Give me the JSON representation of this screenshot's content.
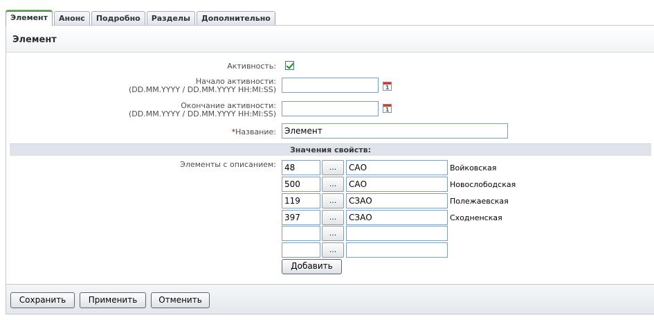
{
  "tabs": [
    {
      "label": "Элемент",
      "active": true
    },
    {
      "label": "Анонс"
    },
    {
      "label": "Подробно"
    },
    {
      "label": "Разделы"
    },
    {
      "label": "Дополнительно"
    }
  ],
  "panel": {
    "title": "Элемент"
  },
  "form": {
    "active_label": "Активность:",
    "active_checked": true,
    "start_label": "Начало активности:",
    "start_format": "(DD.MM.YYYY / DD.MM.YYYY HH:MI:SS)",
    "start_value": "",
    "end_label": "Окончание активности:",
    "end_format": "(DD.MM.YYYY / DD.MM.YYYY HH:MI:SS)",
    "end_value": "",
    "calendar_icon_text": "1",
    "name_required_mark": "*",
    "name_label": "Название:",
    "name_value": "Элемент"
  },
  "properties": {
    "section_title": "Значения свойств:",
    "elements_label": "Элементы с описанием:",
    "browse_label": "...",
    "rows": [
      {
        "id": "48",
        "desc": "САО",
        "name": "Войковская"
      },
      {
        "id": "500",
        "desc": "САО",
        "name": "Новослободская"
      },
      {
        "id": "119",
        "desc": "СЗАО",
        "name": "Полежаевская"
      },
      {
        "id": "397",
        "desc": "СЗАО",
        "name": "Сходненская"
      },
      {
        "id": "",
        "desc": "",
        "name": ""
      },
      {
        "id": "",
        "desc": "",
        "name": ""
      }
    ],
    "add_label": "Добавить"
  },
  "footer": {
    "save_label": "Сохранить",
    "apply_label": "Применить",
    "cancel_label": "Отменить"
  },
  "colors": {
    "active_tab_accent": "#4f9b3b",
    "required_mark": "#c00000",
    "section_bar": "#e0e4ea"
  }
}
